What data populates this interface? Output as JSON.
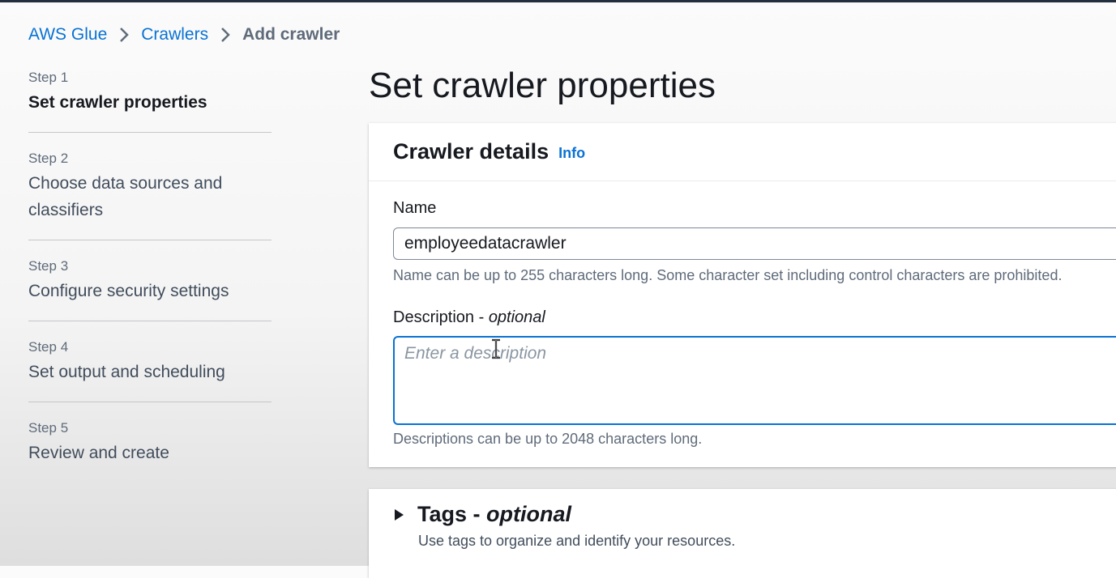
{
  "breadcrumb": {
    "items": [
      "AWS Glue",
      "Crawlers"
    ],
    "current": "Add crawler"
  },
  "steps": [
    {
      "number": "Step 1",
      "title": "Set crawler properties"
    },
    {
      "number": "Step 2",
      "title": "Choose data sources and classifiers"
    },
    {
      "number": "Step 3",
      "title": "Configure security settings"
    },
    {
      "number": "Step 4",
      "title": "Set output and scheduling"
    },
    {
      "number": "Step 5",
      "title": "Review and create"
    }
  ],
  "page": {
    "title": "Set crawler properties"
  },
  "crawler_details": {
    "title": "Crawler details",
    "info": "Info",
    "name": {
      "label": "Name",
      "value": "employeedatacrawler",
      "hint": "Name can be up to 255 characters long. Some character set including control characters are prohibited."
    },
    "description": {
      "label": "Description - ",
      "label_optional": "optional",
      "placeholder": "Enter a description",
      "hint": "Descriptions can be up to 2048 characters long."
    }
  },
  "tags": {
    "title": "Tags - ",
    "title_optional": "optional",
    "description": "Use tags to organize and identify your resources."
  },
  "colors": {
    "link": "#0972d3",
    "text": "#16191f",
    "secondary_text": "#5f6b7a",
    "focus_border": "#0972d3"
  }
}
